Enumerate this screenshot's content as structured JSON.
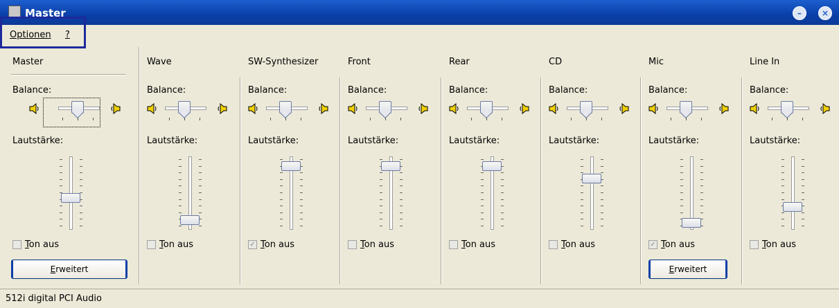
{
  "window": {
    "title": "Master"
  },
  "menu": {
    "items": [
      {
        "label": "Optionen"
      },
      {
        "label": "?"
      }
    ]
  },
  "common": {
    "balance_label": "Balance:",
    "volume_label": "Lautstärke:",
    "mute_label": "Ton aus",
    "advanced_label": "Erweitert"
  },
  "channels": [
    {
      "name": "Master",
      "volume_level": 0.45,
      "muted": false,
      "has_advanced": true
    },
    {
      "name": "Wave",
      "volume_level": 0.1,
      "muted": false,
      "has_advanced": false
    },
    {
      "name": "SW-Synthesizer",
      "volume_level": 0.95,
      "muted": true,
      "has_advanced": false
    },
    {
      "name": "Front",
      "volume_level": 0.95,
      "muted": false,
      "has_advanced": false
    },
    {
      "name": "Rear",
      "volume_level": 0.95,
      "muted": false,
      "has_advanced": false
    },
    {
      "name": "CD",
      "volume_level": 0.75,
      "muted": false,
      "has_advanced": false
    },
    {
      "name": "Mic",
      "volume_level": 0.05,
      "muted": true,
      "has_advanced": true
    },
    {
      "name": "Line In",
      "volume_level": 0.3,
      "muted": false,
      "has_advanced": false
    }
  ],
  "status": {
    "text": "512i digital PCI Audio"
  }
}
